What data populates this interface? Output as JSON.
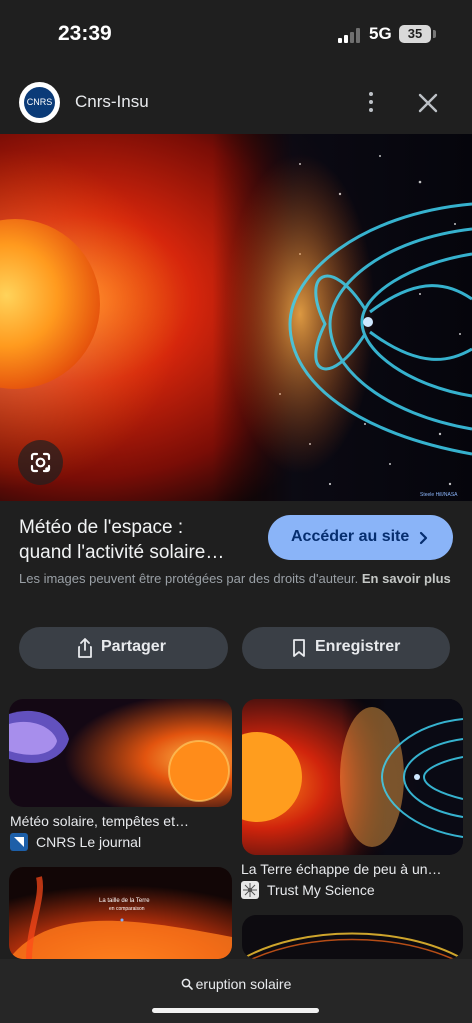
{
  "status_bar": {
    "time": "23:39",
    "network": "5G",
    "battery": "35"
  },
  "header": {
    "source_name": "Cnrs-Insu",
    "logo_text": "CNRS"
  },
  "hero": {
    "credit": "Steele Hill/NASA"
  },
  "result": {
    "title_line1": "Météo de l'espace :",
    "title_line2": "quand l'activité solaire…",
    "visit_label": "Accéder au site",
    "copyright_text": "Les images peuvent être protégées par des droits d'auteur.",
    "learn_more": "En savoir plus"
  },
  "actions": {
    "share_label": "Partager",
    "save_label": "Enregistrer"
  },
  "related": [
    {
      "title": "Météo solaire, tempêtes et…",
      "source": "CNRS Le journal"
    },
    {
      "title": "La Terre échappe de peu à un…",
      "source": "Trust My Science"
    }
  ],
  "related_overlay": {
    "line1": "La taille de la Terre",
    "line2": "en comparaison"
  },
  "bottom": {
    "query": "eruption solaire"
  },
  "colors": {
    "accent": "#8ab4f8",
    "background": "#1f1f1f",
    "chip": "#3a3f46"
  }
}
